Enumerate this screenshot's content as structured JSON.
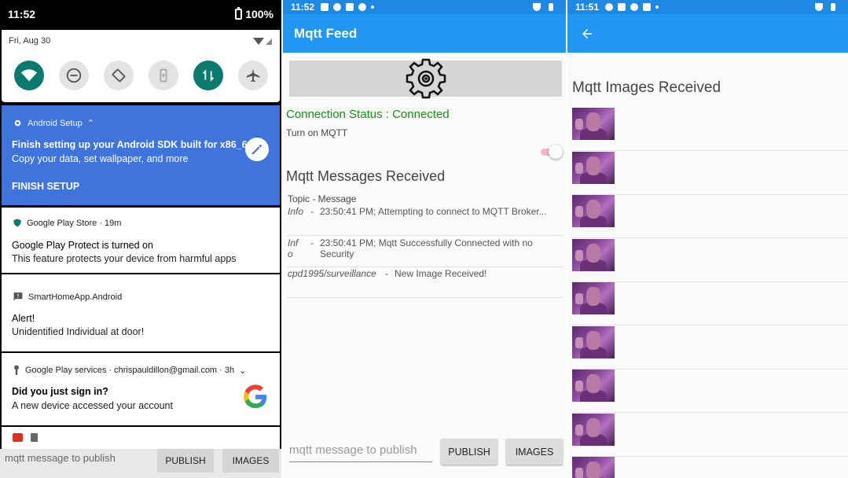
{
  "panel1": {
    "status": {
      "time": "11:52",
      "battery": "100%"
    },
    "quick_settings": {
      "date": "Fri, Aug 30"
    },
    "notifications": {
      "setup": {
        "app": "Android Setup",
        "title": "Finish setting up your Android SDK built for x86_64",
        "body": "Copy your data, set wallpaper, and more",
        "action": "FINISH SETUP"
      },
      "play": {
        "app": "Google Play Store · 19m",
        "title": "Google Play Protect is turned on",
        "body": "This feature protects your device from harmful apps"
      },
      "smart": {
        "app": "SmartHomeApp.Android",
        "title": "Alert!",
        "body": "Unidentified Individual at door!"
      },
      "gps": {
        "app": "Google Play services · chrispauldillon@gmail.com · 3h",
        "title": "Did you just sign in?",
        "body": "A new device accessed your account"
      }
    },
    "behind": {
      "placeholder": "mqtt message to publish",
      "publish": "PUBLISH",
      "images": "IMAGES"
    }
  },
  "panel2": {
    "status_time": "11:52",
    "title": "Mqtt Feed",
    "connection_status": "Connection Status : Connected",
    "toggle_label": "Turn on MQTT",
    "toggle_on": true,
    "messages_heading": "Mqtt Messages Received",
    "table_header": "Topic - Message",
    "messages": [
      {
        "topic": "Info",
        "sep": "-",
        "message": "23:50:41 PM; Attempting to connect to MQTT Broker..."
      },
      {
        "topic": "Inf o",
        "sep": "-",
        "message": "23:50:41 PM; Mqtt Successfully Connected with no Security"
      },
      {
        "topic": "cpd1995/surveillance",
        "sep": "-",
        "message": "New Image Received!"
      }
    ],
    "input_placeholder": "mqtt message to publish",
    "publish_label": "PUBLISH",
    "images_label": "IMAGES"
  },
  "panel3": {
    "status_time": "11:51",
    "heading": "Mqtt Images Received",
    "image_count_visible": 9
  },
  "colors": {
    "primary": "#2196f3",
    "status_bar": "#1e88e5",
    "connected": "#119411",
    "setup_blue": "#3e74dc",
    "qs_active": "#0b7a6e"
  }
}
